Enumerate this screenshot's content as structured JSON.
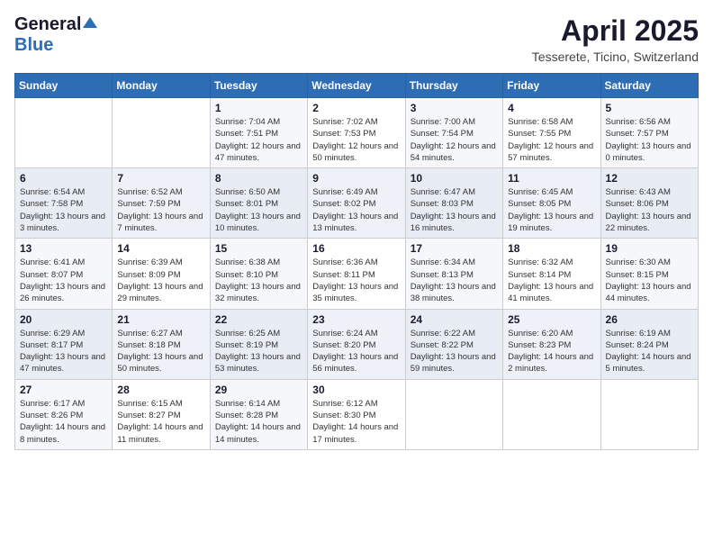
{
  "logo": {
    "general": "General",
    "blue": "Blue"
  },
  "title": "April 2025",
  "subtitle": "Tesserete, Ticino, Switzerland",
  "headers": [
    "Sunday",
    "Monday",
    "Tuesday",
    "Wednesday",
    "Thursday",
    "Friday",
    "Saturday"
  ],
  "weeks": [
    [
      {
        "day": "",
        "info": ""
      },
      {
        "day": "",
        "info": ""
      },
      {
        "day": "1",
        "info": "Sunrise: 7:04 AM\nSunset: 7:51 PM\nDaylight: 12 hours and 47 minutes."
      },
      {
        "day": "2",
        "info": "Sunrise: 7:02 AM\nSunset: 7:53 PM\nDaylight: 12 hours and 50 minutes."
      },
      {
        "day": "3",
        "info": "Sunrise: 7:00 AM\nSunset: 7:54 PM\nDaylight: 12 hours and 54 minutes."
      },
      {
        "day": "4",
        "info": "Sunrise: 6:58 AM\nSunset: 7:55 PM\nDaylight: 12 hours and 57 minutes."
      },
      {
        "day": "5",
        "info": "Sunrise: 6:56 AM\nSunset: 7:57 PM\nDaylight: 13 hours and 0 minutes."
      }
    ],
    [
      {
        "day": "6",
        "info": "Sunrise: 6:54 AM\nSunset: 7:58 PM\nDaylight: 13 hours and 3 minutes."
      },
      {
        "day": "7",
        "info": "Sunrise: 6:52 AM\nSunset: 7:59 PM\nDaylight: 13 hours and 7 minutes."
      },
      {
        "day": "8",
        "info": "Sunrise: 6:50 AM\nSunset: 8:01 PM\nDaylight: 13 hours and 10 minutes."
      },
      {
        "day": "9",
        "info": "Sunrise: 6:49 AM\nSunset: 8:02 PM\nDaylight: 13 hours and 13 minutes."
      },
      {
        "day": "10",
        "info": "Sunrise: 6:47 AM\nSunset: 8:03 PM\nDaylight: 13 hours and 16 minutes."
      },
      {
        "day": "11",
        "info": "Sunrise: 6:45 AM\nSunset: 8:05 PM\nDaylight: 13 hours and 19 minutes."
      },
      {
        "day": "12",
        "info": "Sunrise: 6:43 AM\nSunset: 8:06 PM\nDaylight: 13 hours and 22 minutes."
      }
    ],
    [
      {
        "day": "13",
        "info": "Sunrise: 6:41 AM\nSunset: 8:07 PM\nDaylight: 13 hours and 26 minutes."
      },
      {
        "day": "14",
        "info": "Sunrise: 6:39 AM\nSunset: 8:09 PM\nDaylight: 13 hours and 29 minutes."
      },
      {
        "day": "15",
        "info": "Sunrise: 6:38 AM\nSunset: 8:10 PM\nDaylight: 13 hours and 32 minutes."
      },
      {
        "day": "16",
        "info": "Sunrise: 6:36 AM\nSunset: 8:11 PM\nDaylight: 13 hours and 35 minutes."
      },
      {
        "day": "17",
        "info": "Sunrise: 6:34 AM\nSunset: 8:13 PM\nDaylight: 13 hours and 38 minutes."
      },
      {
        "day": "18",
        "info": "Sunrise: 6:32 AM\nSunset: 8:14 PM\nDaylight: 13 hours and 41 minutes."
      },
      {
        "day": "19",
        "info": "Sunrise: 6:30 AM\nSunset: 8:15 PM\nDaylight: 13 hours and 44 minutes."
      }
    ],
    [
      {
        "day": "20",
        "info": "Sunrise: 6:29 AM\nSunset: 8:17 PM\nDaylight: 13 hours and 47 minutes."
      },
      {
        "day": "21",
        "info": "Sunrise: 6:27 AM\nSunset: 8:18 PM\nDaylight: 13 hours and 50 minutes."
      },
      {
        "day": "22",
        "info": "Sunrise: 6:25 AM\nSunset: 8:19 PM\nDaylight: 13 hours and 53 minutes."
      },
      {
        "day": "23",
        "info": "Sunrise: 6:24 AM\nSunset: 8:20 PM\nDaylight: 13 hours and 56 minutes."
      },
      {
        "day": "24",
        "info": "Sunrise: 6:22 AM\nSunset: 8:22 PM\nDaylight: 13 hours and 59 minutes."
      },
      {
        "day": "25",
        "info": "Sunrise: 6:20 AM\nSunset: 8:23 PM\nDaylight: 14 hours and 2 minutes."
      },
      {
        "day": "26",
        "info": "Sunrise: 6:19 AM\nSunset: 8:24 PM\nDaylight: 14 hours and 5 minutes."
      }
    ],
    [
      {
        "day": "27",
        "info": "Sunrise: 6:17 AM\nSunset: 8:26 PM\nDaylight: 14 hours and 8 minutes."
      },
      {
        "day": "28",
        "info": "Sunrise: 6:15 AM\nSunset: 8:27 PM\nDaylight: 14 hours and 11 minutes."
      },
      {
        "day": "29",
        "info": "Sunrise: 6:14 AM\nSunset: 8:28 PM\nDaylight: 14 hours and 14 minutes."
      },
      {
        "day": "30",
        "info": "Sunrise: 6:12 AM\nSunset: 8:30 PM\nDaylight: 14 hours and 17 minutes."
      },
      {
        "day": "",
        "info": ""
      },
      {
        "day": "",
        "info": ""
      },
      {
        "day": "",
        "info": ""
      }
    ]
  ]
}
